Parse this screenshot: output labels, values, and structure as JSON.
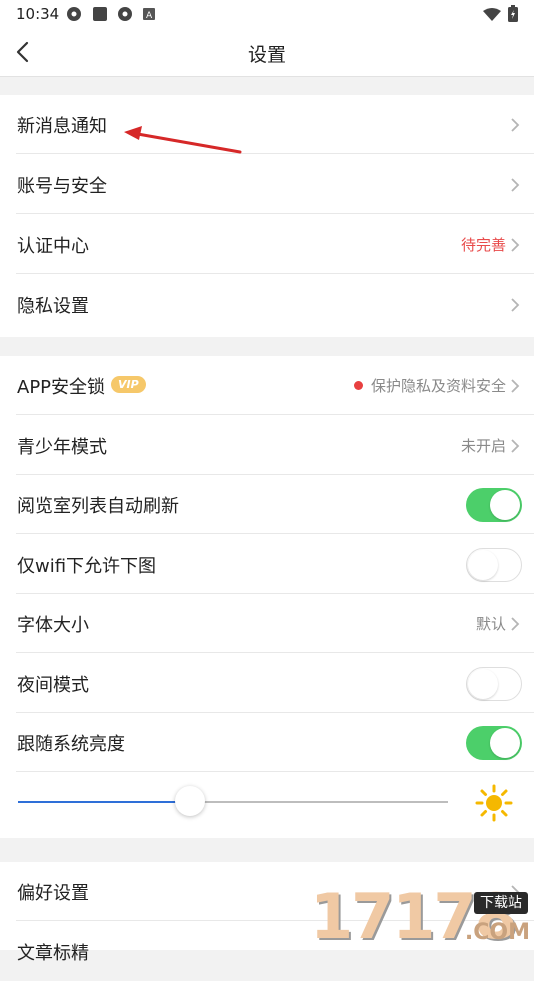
{
  "status_bar": {
    "time": "10:34",
    "icons": [
      "aperture-icon",
      "square-app-icon",
      "aperture-icon",
      "a-badge-icon",
      "wifi-icon",
      "battery-charging-icon"
    ]
  },
  "nav": {
    "title": "设置",
    "back_icon": "back-arrow-icon"
  },
  "group1": [
    {
      "label": "新消息通知",
      "value": ""
    },
    {
      "label": "账号与安全",
      "value": ""
    },
    {
      "label": "认证中心",
      "value": "待完善"
    },
    {
      "label": "隐私设置",
      "value": ""
    }
  ],
  "group2": {
    "app_lock": {
      "label": "APP安全锁",
      "vip": "VIP",
      "value": "保护隐私及资料安全"
    },
    "youth_mode": {
      "label": "青少年模式",
      "value": "未开启"
    },
    "auto_refresh": {
      "label": "阅览室列表自动刷新",
      "state": true
    },
    "wifi_only": {
      "label": "仅wifi下允许下图",
      "state": false
    },
    "font_size": {
      "label": "字体大小",
      "value": "默认"
    },
    "night_mode": {
      "label": "夜间模式",
      "state": false
    },
    "follow_brightness": {
      "label": "跟随系统亮度",
      "state": true
    },
    "brightness_level": 0.4
  },
  "group3": [
    {
      "label": "偏好设置"
    },
    {
      "label": "文章标精"
    }
  ],
  "watermark": {
    "digits": "17178",
    "badge": "下载站",
    "suffix": ".COM"
  },
  "colors": {
    "toggle_on": "#4ccf6a",
    "slider_fill": "#2e6fd8",
    "pending_red": "#e84a4a",
    "annotation_arrow": "#d62828"
  }
}
